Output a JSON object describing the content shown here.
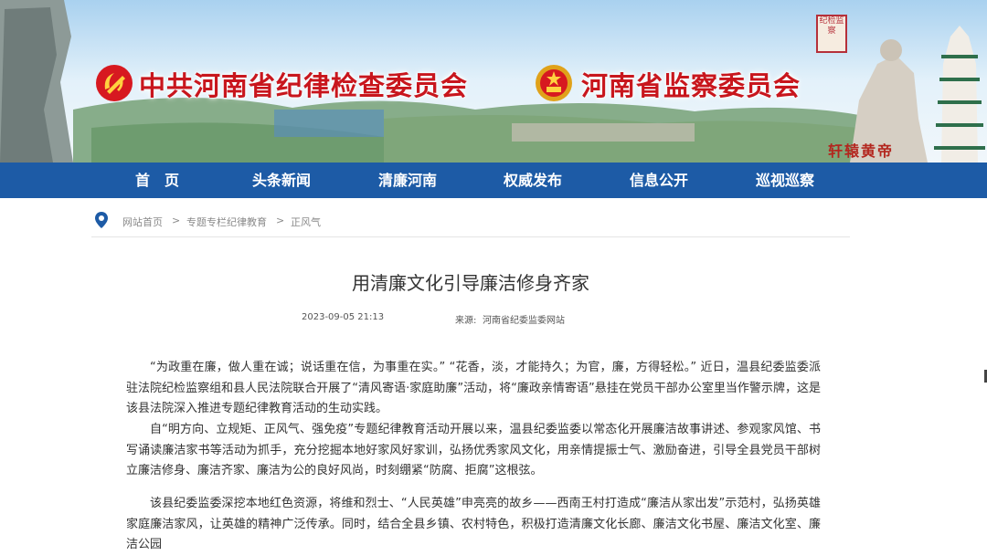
{
  "banner": {
    "title_left": "中共河南省纪律检查委员会",
    "title_right": "河南省监察委员会",
    "stamp_text": "纪检监察",
    "statue_text": "轩辕黄帝",
    "colors": {
      "title_red": "#c8161d",
      "nav_blue": "#1d5ba6"
    }
  },
  "nav": {
    "items": [
      "首　页",
      "头条新闻",
      "清廉河南",
      "权威发布",
      "信息公开",
      "巡视巡察"
    ]
  },
  "breadcrumb": {
    "items": [
      "网站首页",
      "专题专栏纪律教育",
      "正风气"
    ],
    "separator": ">"
  },
  "article": {
    "title": "用清廉文化引导廉洁修身齐家",
    "date": "2023-09-05 21:13",
    "source_label": "来源:",
    "source": "河南省纪委监委网站",
    "paragraphs": [
      "“为政重在廉，做人重在诚；说话重在信，为事重在实。” “花香，淡，才能持久；为官，廉，方得轻松。” 近日，温县纪委监委派驻法院纪检监察组和县人民法院联合开展了“清风寄语·家庭助廉”活动，将“廉政亲情寄语”悬挂在党员干部办公室里当作警示牌，这是该县法院深入推进专题纪律教育活动的生动实践。",
      "自“明方向、立规矩、正风气、强免疫”专题纪律教育活动开展以来，温县纪委监委以常态化开展廉洁故事讲述、参观家风馆、书写诵读廉洁家书等活动为抓手，充分挖掘本地好家风好家训，弘扬优秀家风文化，用亲情提振士气、激励奋进，引导全县党员干部树立廉洁修身、廉洁齐家、廉洁为公的良好风尚，时刻绷紧“防腐、拒腐”这根弦。",
      "该县纪委监委深挖本地红色资源，将维和烈士、“人民英雄”申亮亮的故乡——西南王村打造成“廉洁从家出发”示范村，弘扬英雄家庭廉洁家风，让英雄的精神广泛传承。同时，结合全县乡镇、农村特色，积极打造清廉文化长廊、廉洁文化书屋、廉洁文化室、廉洁公园"
    ]
  }
}
